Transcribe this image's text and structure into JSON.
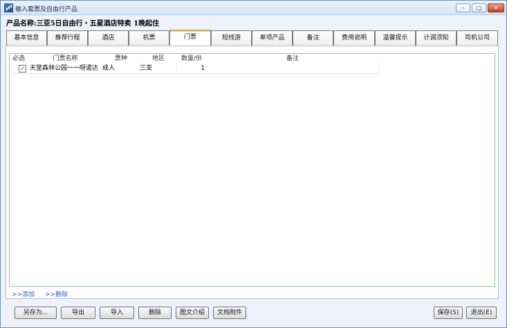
{
  "window": {
    "title": "输入套票及自由行产品",
    "controls": {
      "minimize": "–",
      "maximize": "□",
      "close": "✕"
    }
  },
  "product_line": "产品名称:三亚5日自由行・五星酒店特卖  1晚起住",
  "tabs": [
    {
      "label": "基本信息"
    },
    {
      "label": "推荐行程"
    },
    {
      "label": "酒店"
    },
    {
      "label": "机票"
    },
    {
      "label": "门票",
      "active": true
    },
    {
      "label": "短线游"
    },
    {
      "label": "单项产品"
    },
    {
      "label": "备注"
    },
    {
      "label": "费用说明"
    },
    {
      "label": "温馨提示"
    },
    {
      "label": "计调须知"
    },
    {
      "label": "司机公司"
    }
  ],
  "table": {
    "columns": [
      "必选",
      "门票名称",
      "票种",
      "地区",
      "数量/份",
      "备注"
    ],
    "rows": [
      {
        "checked": true,
        "checkbox_mark": "✓",
        "name": "天堂森林公园一一呀诺达",
        "ticket_type": "成人",
        "region": "三亚",
        "quantity": "1",
        "note": ""
      }
    ]
  },
  "links": {
    "add": ">>添加",
    "delete": ">>删除"
  },
  "buttons": {
    "save_as": "另存为...",
    "export": "导出",
    "import": "导入",
    "delete": "删除",
    "rich_intro": "图文介绍",
    "doc_attach": "文档附件",
    "save": "保存(S)",
    "exit": "退出(E)"
  }
}
